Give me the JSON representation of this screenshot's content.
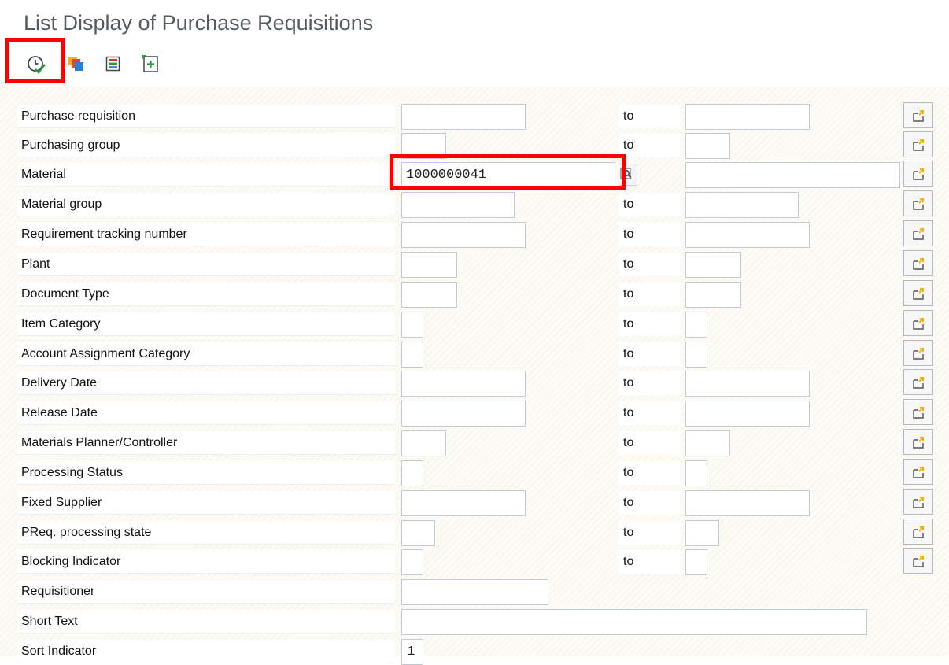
{
  "window": {
    "title": "List Display of Purchase Requisitions"
  },
  "toolbar": {
    "buttons": [
      {
        "icon": "execute-icon",
        "tooltip": ""
      },
      {
        "icon": "get-variant-icon",
        "tooltip": ""
      },
      {
        "icon": "list-icon",
        "tooltip": ""
      },
      {
        "icon": "add-icon",
        "tooltip": ""
      }
    ]
  },
  "form": {
    "to_label": "to",
    "fields": [
      {
        "label": "Purchase requisition",
        "low": "",
        "high": ""
      },
      {
        "label": "Purchasing group",
        "low": "",
        "high": ""
      },
      {
        "label": "Material",
        "low": "1000000041",
        "high": ""
      },
      {
        "label": "Material group",
        "low": "",
        "high": ""
      },
      {
        "label": "Requirement tracking number",
        "low": "",
        "high": ""
      },
      {
        "label": "Plant",
        "low": "",
        "high": ""
      },
      {
        "label": "Document Type",
        "low": "",
        "high": ""
      },
      {
        "label": "Item Category",
        "low": "",
        "high": ""
      },
      {
        "label": "Account Assignment Category",
        "low": "",
        "high": ""
      },
      {
        "label": "Delivery Date",
        "low": "",
        "high": ""
      },
      {
        "label": "Release Date",
        "low": "",
        "high": ""
      },
      {
        "label": "Materials Planner/Controller",
        "low": "",
        "high": ""
      },
      {
        "label": "Processing Status",
        "low": "",
        "high": ""
      },
      {
        "label": "Fixed Supplier",
        "low": "",
        "high": ""
      },
      {
        "label": "PReq. processing state",
        "low": "",
        "high": ""
      },
      {
        "label": "Blocking Indicator",
        "low": "",
        "high": ""
      },
      {
        "label": "Requisitioner",
        "value": ""
      },
      {
        "label": "Short Text",
        "value": ""
      },
      {
        "label": "Sort Indicator",
        "value": "1"
      }
    ]
  },
  "colors": {
    "highlight": "#ff0000",
    "title_text": "#555b63",
    "multiple_selection_arrow": "#f0b400"
  }
}
